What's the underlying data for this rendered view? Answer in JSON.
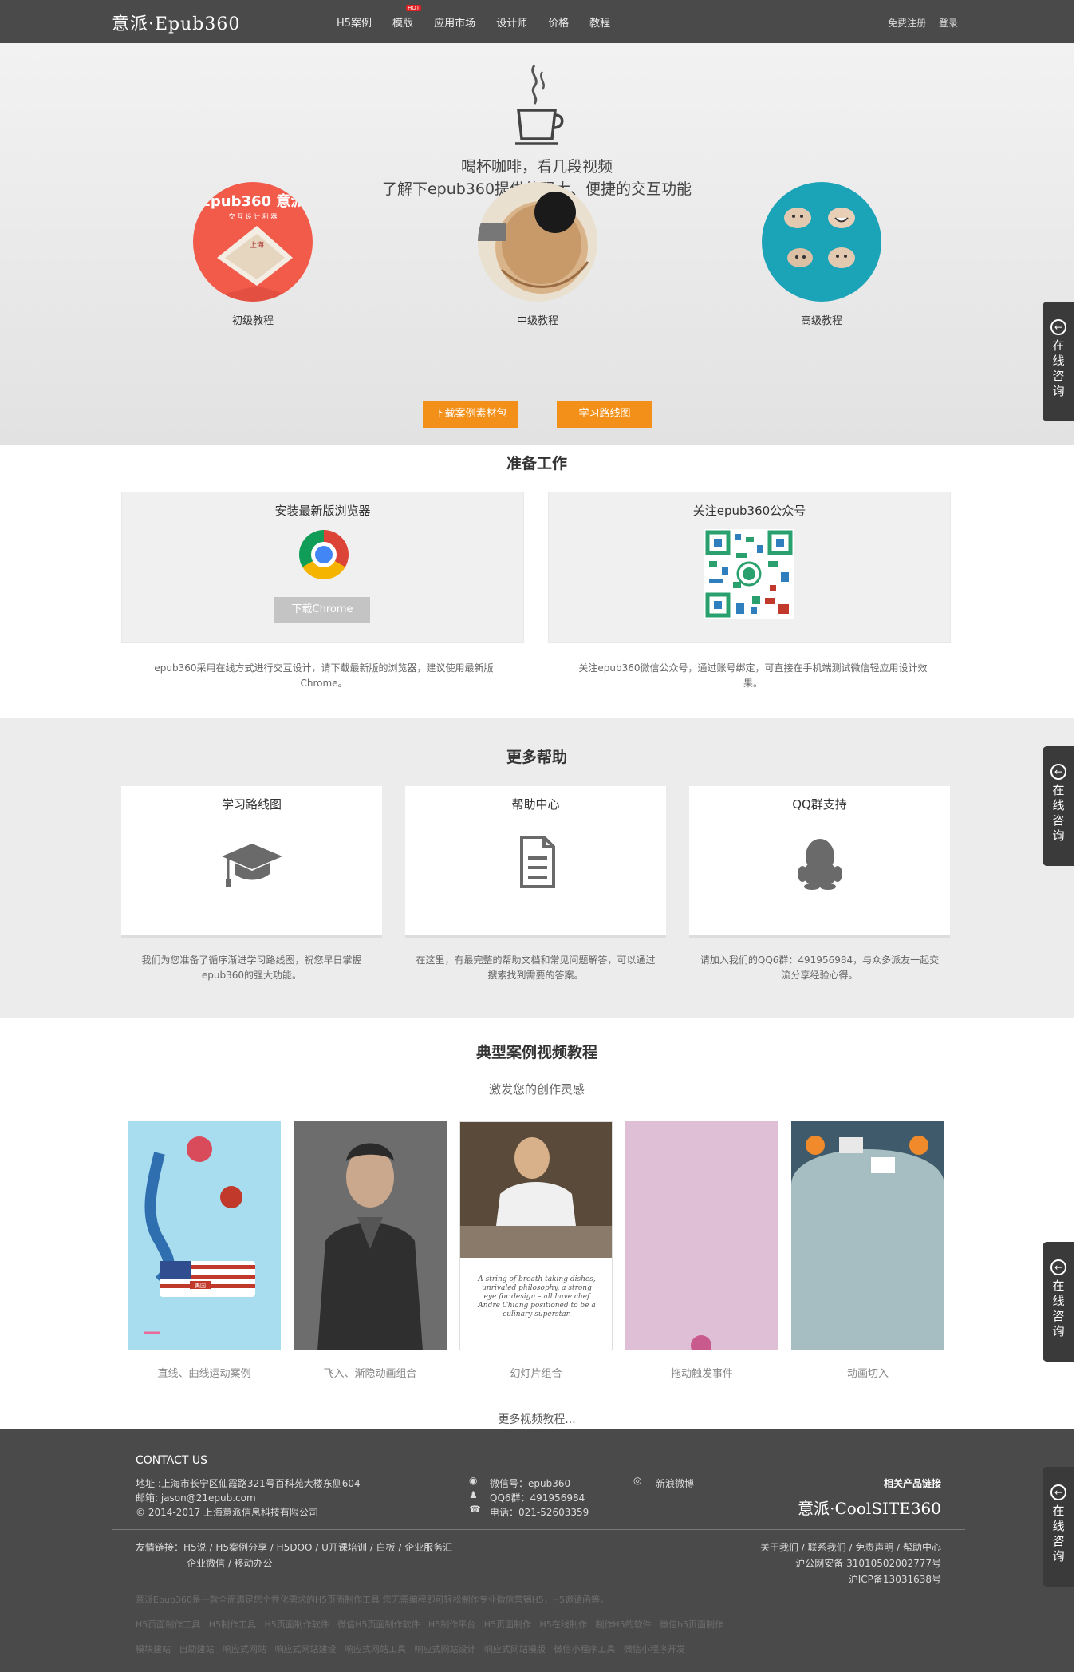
{
  "header": {
    "logo": "意派·Epub360",
    "nav": [
      {
        "label": "H5案例"
      },
      {
        "label": "模版",
        "badge": "HOT"
      },
      {
        "label": "应用市场"
      },
      {
        "label": "设计师"
      },
      {
        "label": "价格"
      },
      {
        "label": "教程"
      }
    ],
    "register": "免费注册",
    "login": "登录"
  },
  "hero": {
    "line1": "喝杯咖啡，看几段视频",
    "line2": "了解下epub360提供的强大、便捷的交互功能",
    "tutorials": [
      {
        "label": "初级教程",
        "image_text": "Epub360 意派",
        "image_sub": "交 互 设 计 利 器",
        "image_stamp": "上海"
      },
      {
        "label": "中级教程"
      },
      {
        "label": "高级教程"
      }
    ],
    "download_btn": "下载案例素材包",
    "roadmap_btn": "学习路线图"
  },
  "prep": {
    "title": "准备工作",
    "browser_card_title": "安装最新版浏览器",
    "chrome_btn": "下载Chrome",
    "browser_desc": "epub360采用在线方式进行交互设计，请下载最新版的浏览器，建议使用最新版Chrome。",
    "wechat_card_title": "关注epub360公众号",
    "wechat_desc": "关注epub360微信公众号，通过账号绑定，可直接在手机端测试微信轻应用设计效果。"
  },
  "help": {
    "title": "更多帮助",
    "cards": [
      {
        "title": "学习路线图",
        "desc": "我们为您准备了循序渐进学习路线图，祝您早日掌握epub360的强大功能。"
      },
      {
        "title": "帮助中心",
        "desc": "在这里，有最完整的帮助文档和常见问题解答，可以通过搜索找到需要的答案。"
      },
      {
        "title": "QQ群支持",
        "desc": "请加入我们的QQ6群：491956984，与众多派友一起交流分享经验心得。"
      }
    ]
  },
  "cases": {
    "title": "典型案例视频教程",
    "subtitle": "激发您的创作灵感",
    "items": [
      {
        "label": "直线、曲线运动案例",
        "thumb_text": "美国"
      },
      {
        "label": "飞入、渐隐动画组合"
      },
      {
        "label": "幻灯片组合",
        "thumb_text": "A string of breath taking dishes, unrivaled philosophy, a strong eye for design – all have chef Andre Chiang positioned to be a culinary superstar."
      },
      {
        "label": "拖动触发事件"
      },
      {
        "label": "动画切入"
      }
    ],
    "more": "更多视频教程..."
  },
  "footer": {
    "contact_title": "CONTACT US",
    "address": "地址 :上海市长宁区仙霞路321号百科苑大楼东侧604",
    "email": "邮箱: jason@21epub.com",
    "copyright": "© 2014-2017 上海意派信息科技有限公司",
    "wechat": "微信号：epub360",
    "qq": "QQ6群：491956984",
    "phone": "电话：021-52603359",
    "weibo": "新浪微博",
    "related_title": "相关产品链接",
    "related_logo": "意派·CoolSITE360",
    "friend_links_line1": "友情链接：H5说 /  H5案例分享 /  H5DOO /  U开课培训 /  白板 /  企业服务汇",
    "friend_links_line2": "企业微信 /  移动办公",
    "about_links": "关于我们 / 联系我们 / 免责声明 / 帮助中心",
    "police": "沪公网安备 31010502002777号",
    "icp": "沪ICP备13031638号",
    "slogan": "意派Epub360是一款全面满足您个性化需求的H5页面制作工具 您无需编程即可轻松制作专业微信营销H5，H5邀请函等。",
    "seo_line1": "H5页面制作工具   H5制作工具   H5页面制作软件   微信H5页面制作软件   H5制作平台   H5页面制作   H5在线制作   制作H5的软件   微信h5页面制作",
    "seo_line2": "模块建站   自助建站   响应式网站   响应式网站建设   响应式网站工具   响应式网站设计   响应式网站模版   微信小程序工具   微信小程序开发"
  },
  "side_tab": {
    "icon": "consult-icon",
    "label": "在线咨询"
  },
  "colors": {
    "header_bg": "#4a4a4a",
    "orange": "#f39019",
    "teal": "#1ba3b8",
    "coral": "#f25a4a"
  }
}
